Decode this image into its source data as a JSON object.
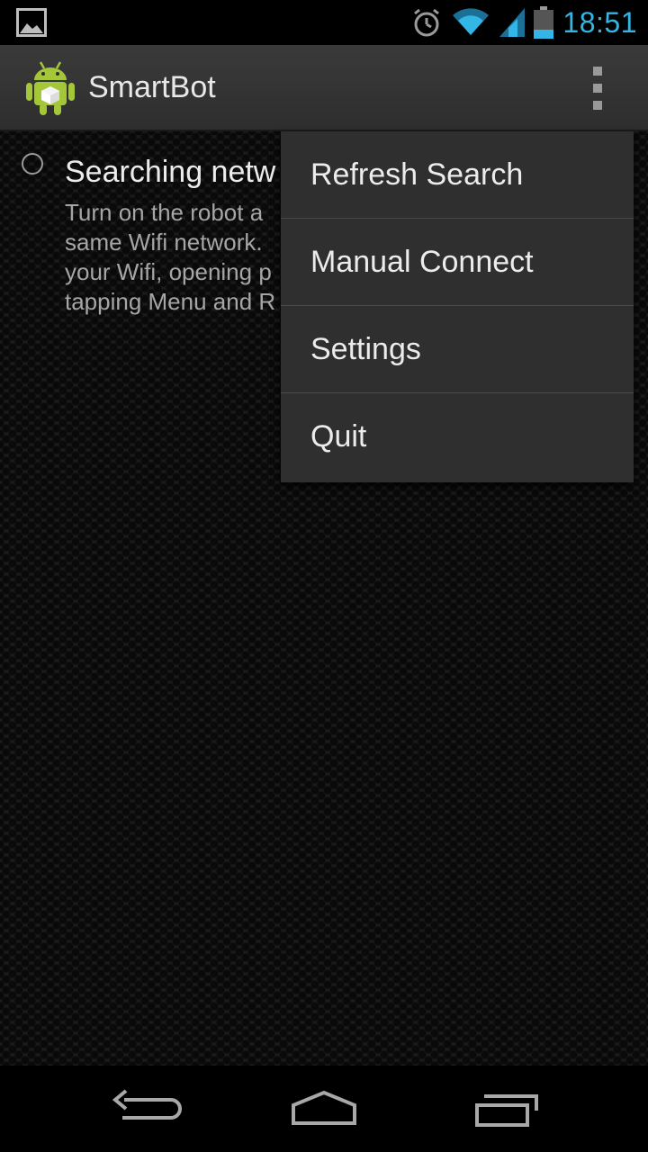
{
  "status_bar": {
    "time": "18:51",
    "icons": [
      "gallery-icon",
      "alarm-icon",
      "wifi-icon",
      "signal-icon",
      "battery-icon"
    ]
  },
  "action_bar": {
    "title": "SmartBot",
    "app_icon": "android-robot-icon",
    "overflow_icon": "overflow-menu-icon"
  },
  "content": {
    "item": {
      "title": "Searching netw",
      "description_lines": [
        "Turn on the robot a",
        "same Wifi network.",
        "your Wifi, opening p",
        "tapping Menu and R"
      ]
    }
  },
  "menu": {
    "items": [
      {
        "label": "Refresh Search"
      },
      {
        "label": "Manual Connect"
      },
      {
        "label": "Settings"
      },
      {
        "label": "Quit"
      }
    ]
  },
  "nav_bar": {
    "buttons": [
      "back-icon",
      "home-icon",
      "recent-apps-icon"
    ]
  },
  "colors": {
    "accent": "#33b5e5",
    "android_green": "#a4c639"
  }
}
